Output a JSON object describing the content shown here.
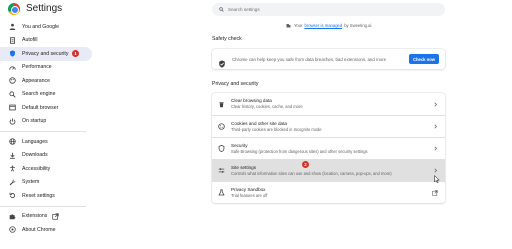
{
  "app": {
    "title": "Settings"
  },
  "sidebar": {
    "items": [
      {
        "label": "You and Google",
        "icon": "person-icon"
      },
      {
        "label": "Autofill",
        "icon": "clipboard-icon"
      },
      {
        "label": "Privacy and security",
        "icon": "shield-icon",
        "active": true,
        "badge": "1"
      },
      {
        "label": "Performance",
        "icon": "speedometer-icon"
      },
      {
        "label": "Appearance",
        "icon": "palette-icon"
      },
      {
        "label": "Search engine",
        "icon": "search-icon"
      },
      {
        "label": "Default browser",
        "icon": "browser-icon"
      },
      {
        "label": "On startup",
        "icon": "power-icon"
      },
      {
        "label": "Languages",
        "icon": "globe-icon"
      },
      {
        "label": "Downloads",
        "icon": "download-icon"
      },
      {
        "label": "Accessibility",
        "icon": "accessibility-icon"
      },
      {
        "label": "System",
        "icon": "wrench-icon"
      },
      {
        "label": "Reset settings",
        "icon": "reset-icon"
      },
      {
        "label": "Extensions",
        "icon": "puzzle-icon"
      },
      {
        "label": "About Chrome",
        "icon": "chrome-icon"
      }
    ]
  },
  "search": {
    "placeholder": "Search settings"
  },
  "managed": {
    "prefix": "Your",
    "link": "browser is managed",
    "suffix": "by Sweeting.ai"
  },
  "safety_check": {
    "title": "Safety check",
    "text": "Chrome can help keep you safe from data breaches, bad extensions, and more",
    "button": "Check now"
  },
  "privacy": {
    "title": "Privacy and security",
    "rows": [
      {
        "title": "Clear browsing data",
        "subtitle": "Clear history, cookies, cache, and more",
        "icon": "trash-icon"
      },
      {
        "title": "Cookies and other site data",
        "subtitle": "Third-party cookies are blocked in Incognito mode",
        "icon": "cookie-icon"
      },
      {
        "title": "Security",
        "subtitle": "Safe Browsing (protection from dangerous sites) and other security settings",
        "icon": "shield-icon"
      },
      {
        "title": "Site settings",
        "subtitle": "Controls what information sites can use and show (location, camera, pop-ups, and more)",
        "icon": "sliders-icon",
        "highlight": true,
        "badge": "2"
      },
      {
        "title": "Privacy Sandbox",
        "subtitle": "Trial features are off",
        "icon": "flask-icon",
        "external": true
      }
    ]
  },
  "colors": {
    "accent": "#1a73e8",
    "badge": "#d93025",
    "active_bg": "#e8eaf6"
  }
}
